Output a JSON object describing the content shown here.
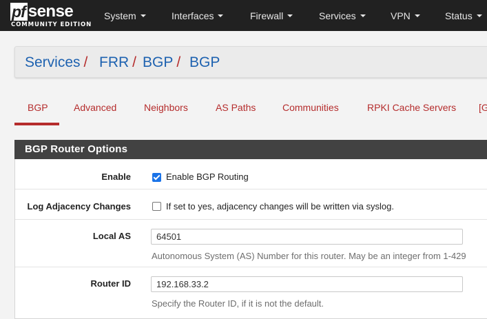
{
  "brand": {
    "logo_pf": "pf",
    "logo_sense": "sense",
    "edition": "COMMUNITY EDITION"
  },
  "nav": [
    {
      "label": "System"
    },
    {
      "label": "Interfaces"
    },
    {
      "label": "Firewall"
    },
    {
      "label": "Services"
    },
    {
      "label": "VPN"
    },
    {
      "label": "Status"
    }
  ],
  "breadcrumb": [
    "Services",
    "FRR",
    "BGP",
    "BGP"
  ],
  "breadcrumb_sep": "/",
  "tabs": [
    {
      "label": "BGP",
      "active": true
    },
    {
      "label": "Advanced"
    },
    {
      "label": "Neighbors"
    },
    {
      "label": "AS Paths"
    },
    {
      "label": "Communities"
    },
    {
      "label": "RPKI Cache Servers"
    },
    {
      "label": "[G"
    }
  ],
  "panel": {
    "title": "BGP Router Options",
    "rows": {
      "enable": {
        "label": "Enable",
        "checkbox_text": "Enable BGP Routing",
        "checked": true
      },
      "log_adjacency": {
        "label": "Log Adjacency Changes",
        "checkbox_text": "If set to yes, adjacency changes will be written via syslog.",
        "checked": false
      },
      "local_as": {
        "label": "Local AS",
        "value": "64501",
        "help": "Autonomous System (AS) Number for this router. May be an integer from 1-429"
      },
      "router_id": {
        "label": "Router ID",
        "value": "192.168.33.2",
        "help": "Specify the Router ID, if it is not the default."
      }
    }
  },
  "colors": {
    "navbar": "#212121",
    "link": "#1e62b0",
    "accent_red": "#b52c2c",
    "panel_heading": "#424242",
    "checkbox_on": "#1a73e8"
  }
}
